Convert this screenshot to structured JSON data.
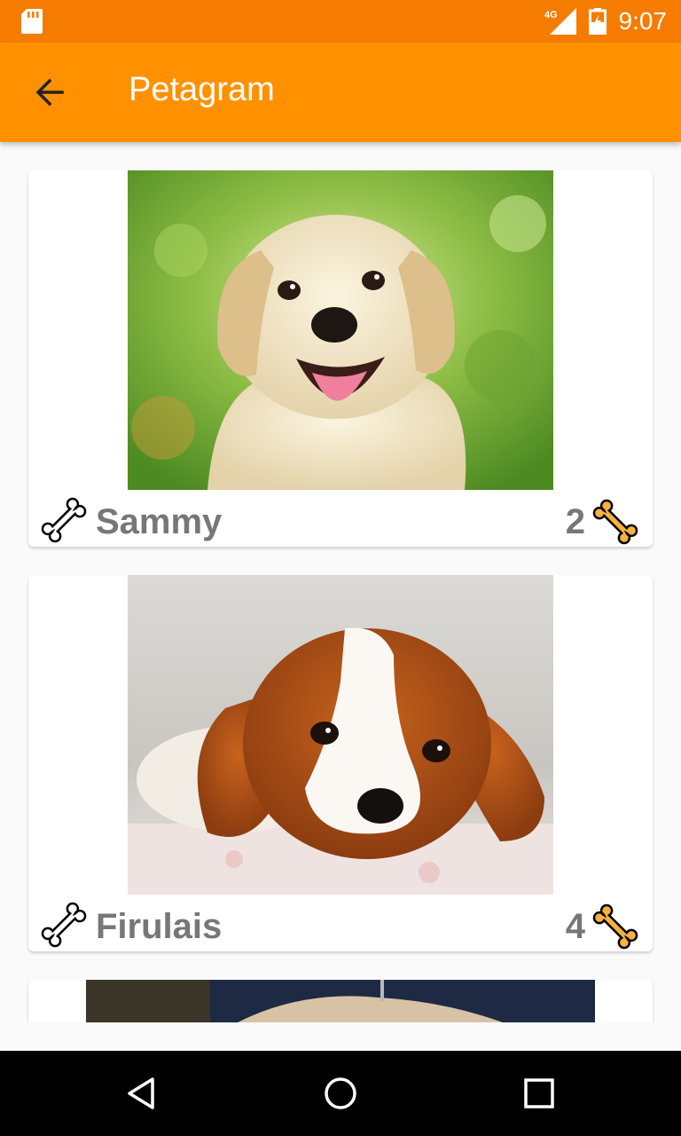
{
  "status_bar": {
    "time": "9:07",
    "network": "4G",
    "icons": [
      "sd-card-icon",
      "signal-icon",
      "battery-icon"
    ]
  },
  "app_bar": {
    "title": "Petagram",
    "back_icon": "arrow-back-icon"
  },
  "pets": [
    {
      "name": "Sammy",
      "likes": "2"
    },
    {
      "name": "Firulais",
      "likes": "4"
    }
  ],
  "nav_bar": {
    "icons": [
      "back-triangle-icon",
      "home-circle-icon",
      "recents-square-icon"
    ]
  },
  "colors": {
    "status_bar": "#f57c00",
    "app_bar": "#ff9100",
    "bone_fill": "#f7b13c"
  }
}
